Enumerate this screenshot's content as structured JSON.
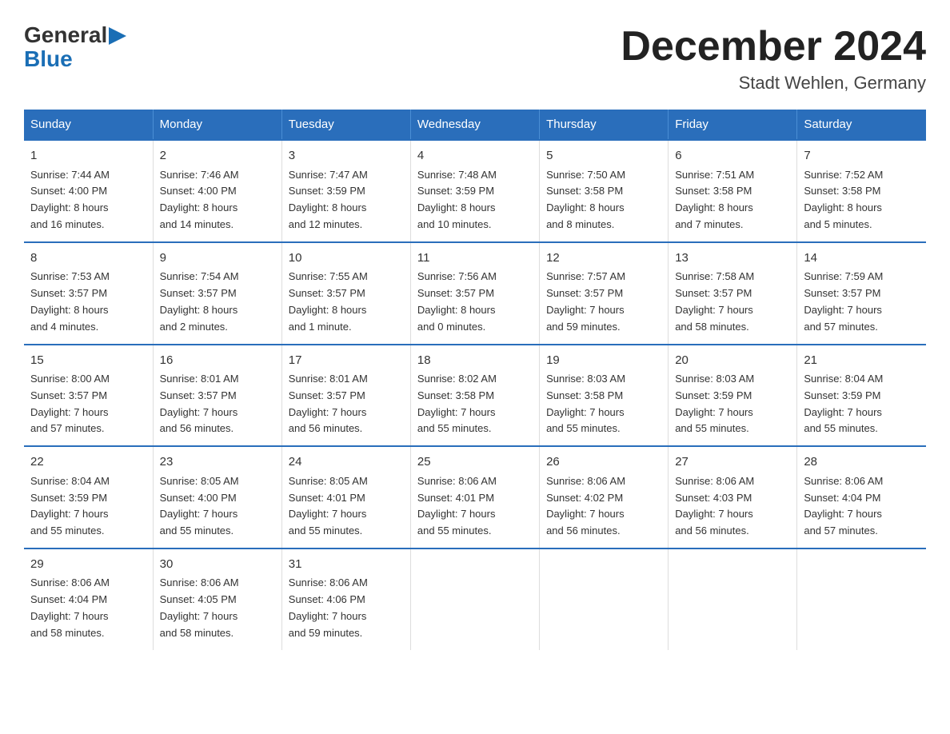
{
  "logo": {
    "general": "General",
    "blue": "Blue",
    "arrow": "▶"
  },
  "title": "December 2024",
  "subtitle": "Stadt Wehlen, Germany",
  "days_header": [
    "Sunday",
    "Monday",
    "Tuesday",
    "Wednesday",
    "Thursday",
    "Friday",
    "Saturday"
  ],
  "weeks": [
    [
      {
        "day": "1",
        "info": "Sunrise: 7:44 AM\nSunset: 4:00 PM\nDaylight: 8 hours\nand 16 minutes."
      },
      {
        "day": "2",
        "info": "Sunrise: 7:46 AM\nSunset: 4:00 PM\nDaylight: 8 hours\nand 14 minutes."
      },
      {
        "day": "3",
        "info": "Sunrise: 7:47 AM\nSunset: 3:59 PM\nDaylight: 8 hours\nand 12 minutes."
      },
      {
        "day": "4",
        "info": "Sunrise: 7:48 AM\nSunset: 3:59 PM\nDaylight: 8 hours\nand 10 minutes."
      },
      {
        "day": "5",
        "info": "Sunrise: 7:50 AM\nSunset: 3:58 PM\nDaylight: 8 hours\nand 8 minutes."
      },
      {
        "day": "6",
        "info": "Sunrise: 7:51 AM\nSunset: 3:58 PM\nDaylight: 8 hours\nand 7 minutes."
      },
      {
        "day": "7",
        "info": "Sunrise: 7:52 AM\nSunset: 3:58 PM\nDaylight: 8 hours\nand 5 minutes."
      }
    ],
    [
      {
        "day": "8",
        "info": "Sunrise: 7:53 AM\nSunset: 3:57 PM\nDaylight: 8 hours\nand 4 minutes."
      },
      {
        "day": "9",
        "info": "Sunrise: 7:54 AM\nSunset: 3:57 PM\nDaylight: 8 hours\nand 2 minutes."
      },
      {
        "day": "10",
        "info": "Sunrise: 7:55 AM\nSunset: 3:57 PM\nDaylight: 8 hours\nand 1 minute."
      },
      {
        "day": "11",
        "info": "Sunrise: 7:56 AM\nSunset: 3:57 PM\nDaylight: 8 hours\nand 0 minutes."
      },
      {
        "day": "12",
        "info": "Sunrise: 7:57 AM\nSunset: 3:57 PM\nDaylight: 7 hours\nand 59 minutes."
      },
      {
        "day": "13",
        "info": "Sunrise: 7:58 AM\nSunset: 3:57 PM\nDaylight: 7 hours\nand 58 minutes."
      },
      {
        "day": "14",
        "info": "Sunrise: 7:59 AM\nSunset: 3:57 PM\nDaylight: 7 hours\nand 57 minutes."
      }
    ],
    [
      {
        "day": "15",
        "info": "Sunrise: 8:00 AM\nSunset: 3:57 PM\nDaylight: 7 hours\nand 57 minutes."
      },
      {
        "day": "16",
        "info": "Sunrise: 8:01 AM\nSunset: 3:57 PM\nDaylight: 7 hours\nand 56 minutes."
      },
      {
        "day": "17",
        "info": "Sunrise: 8:01 AM\nSunset: 3:57 PM\nDaylight: 7 hours\nand 56 minutes."
      },
      {
        "day": "18",
        "info": "Sunrise: 8:02 AM\nSunset: 3:58 PM\nDaylight: 7 hours\nand 55 minutes."
      },
      {
        "day": "19",
        "info": "Sunrise: 8:03 AM\nSunset: 3:58 PM\nDaylight: 7 hours\nand 55 minutes."
      },
      {
        "day": "20",
        "info": "Sunrise: 8:03 AM\nSunset: 3:59 PM\nDaylight: 7 hours\nand 55 minutes."
      },
      {
        "day": "21",
        "info": "Sunrise: 8:04 AM\nSunset: 3:59 PM\nDaylight: 7 hours\nand 55 minutes."
      }
    ],
    [
      {
        "day": "22",
        "info": "Sunrise: 8:04 AM\nSunset: 3:59 PM\nDaylight: 7 hours\nand 55 minutes."
      },
      {
        "day": "23",
        "info": "Sunrise: 8:05 AM\nSunset: 4:00 PM\nDaylight: 7 hours\nand 55 minutes."
      },
      {
        "day": "24",
        "info": "Sunrise: 8:05 AM\nSunset: 4:01 PM\nDaylight: 7 hours\nand 55 minutes."
      },
      {
        "day": "25",
        "info": "Sunrise: 8:06 AM\nSunset: 4:01 PM\nDaylight: 7 hours\nand 55 minutes."
      },
      {
        "day": "26",
        "info": "Sunrise: 8:06 AM\nSunset: 4:02 PM\nDaylight: 7 hours\nand 56 minutes."
      },
      {
        "day": "27",
        "info": "Sunrise: 8:06 AM\nSunset: 4:03 PM\nDaylight: 7 hours\nand 56 minutes."
      },
      {
        "day": "28",
        "info": "Sunrise: 8:06 AM\nSunset: 4:04 PM\nDaylight: 7 hours\nand 57 minutes."
      }
    ],
    [
      {
        "day": "29",
        "info": "Sunrise: 8:06 AM\nSunset: 4:04 PM\nDaylight: 7 hours\nand 58 minutes."
      },
      {
        "day": "30",
        "info": "Sunrise: 8:06 AM\nSunset: 4:05 PM\nDaylight: 7 hours\nand 58 minutes."
      },
      {
        "day": "31",
        "info": "Sunrise: 8:06 AM\nSunset: 4:06 PM\nDaylight: 7 hours\nand 59 minutes."
      },
      {
        "day": "",
        "info": ""
      },
      {
        "day": "",
        "info": ""
      },
      {
        "day": "",
        "info": ""
      },
      {
        "day": "",
        "info": ""
      }
    ]
  ]
}
